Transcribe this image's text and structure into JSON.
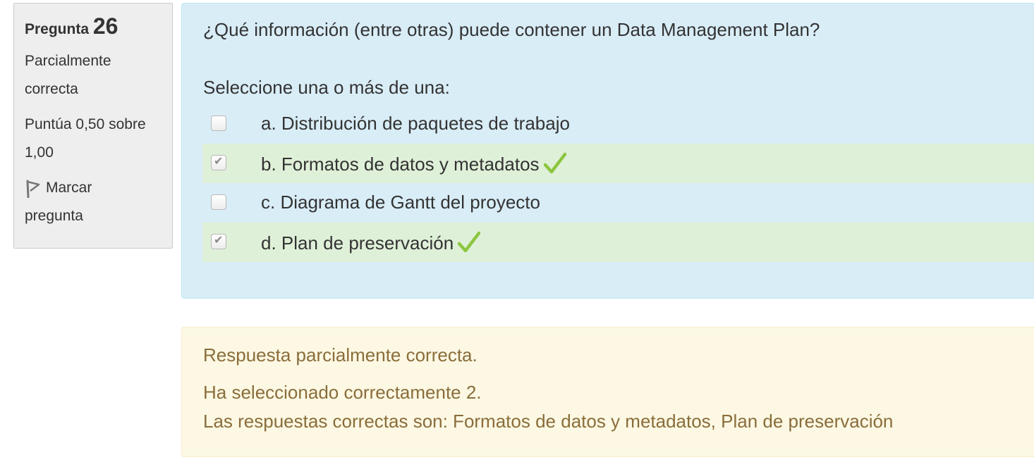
{
  "info": {
    "question_label": "Pregunta",
    "question_number": "26",
    "state_line1": "Parcialmente",
    "state_line2": "correcta",
    "grade_line1": "Puntúa 0,50 sobre",
    "grade_line2": "1,00",
    "flag_line1": "Marcar",
    "flag_line2": "pregunta",
    "flag_icon": "flag-icon"
  },
  "question": {
    "text": "¿Qué información (entre otras) puede contener un Data Management Plan?",
    "prompt": "Seleccione una o más de una:",
    "options": [
      {
        "label": "a. Distribución de paquetes de trabajo",
        "checked": false,
        "correct": false
      },
      {
        "label": "b. Formatos de datos y metadatos",
        "checked": true,
        "correct": true
      },
      {
        "label": "c. Diagrama de Gantt del proyecto",
        "checked": false,
        "correct": false
      },
      {
        "label": "d. Plan de preservación",
        "checked": true,
        "correct": true
      }
    ]
  },
  "feedback": {
    "summary": "Respuesta parcialmente correcta.",
    "selected_correctly": "Ha seleccionado correctamente 2.",
    "right_answers": "Las respuestas correctas son: Formatos de datos y metadatos, Plan de preservación"
  },
  "colors": {
    "question_bg": "#d9edf7",
    "correct_bg": "#dff0d8",
    "feedback_bg": "#fcf8e3",
    "feedback_text": "#8a6d3b",
    "tick_green": "#8cc63f"
  }
}
